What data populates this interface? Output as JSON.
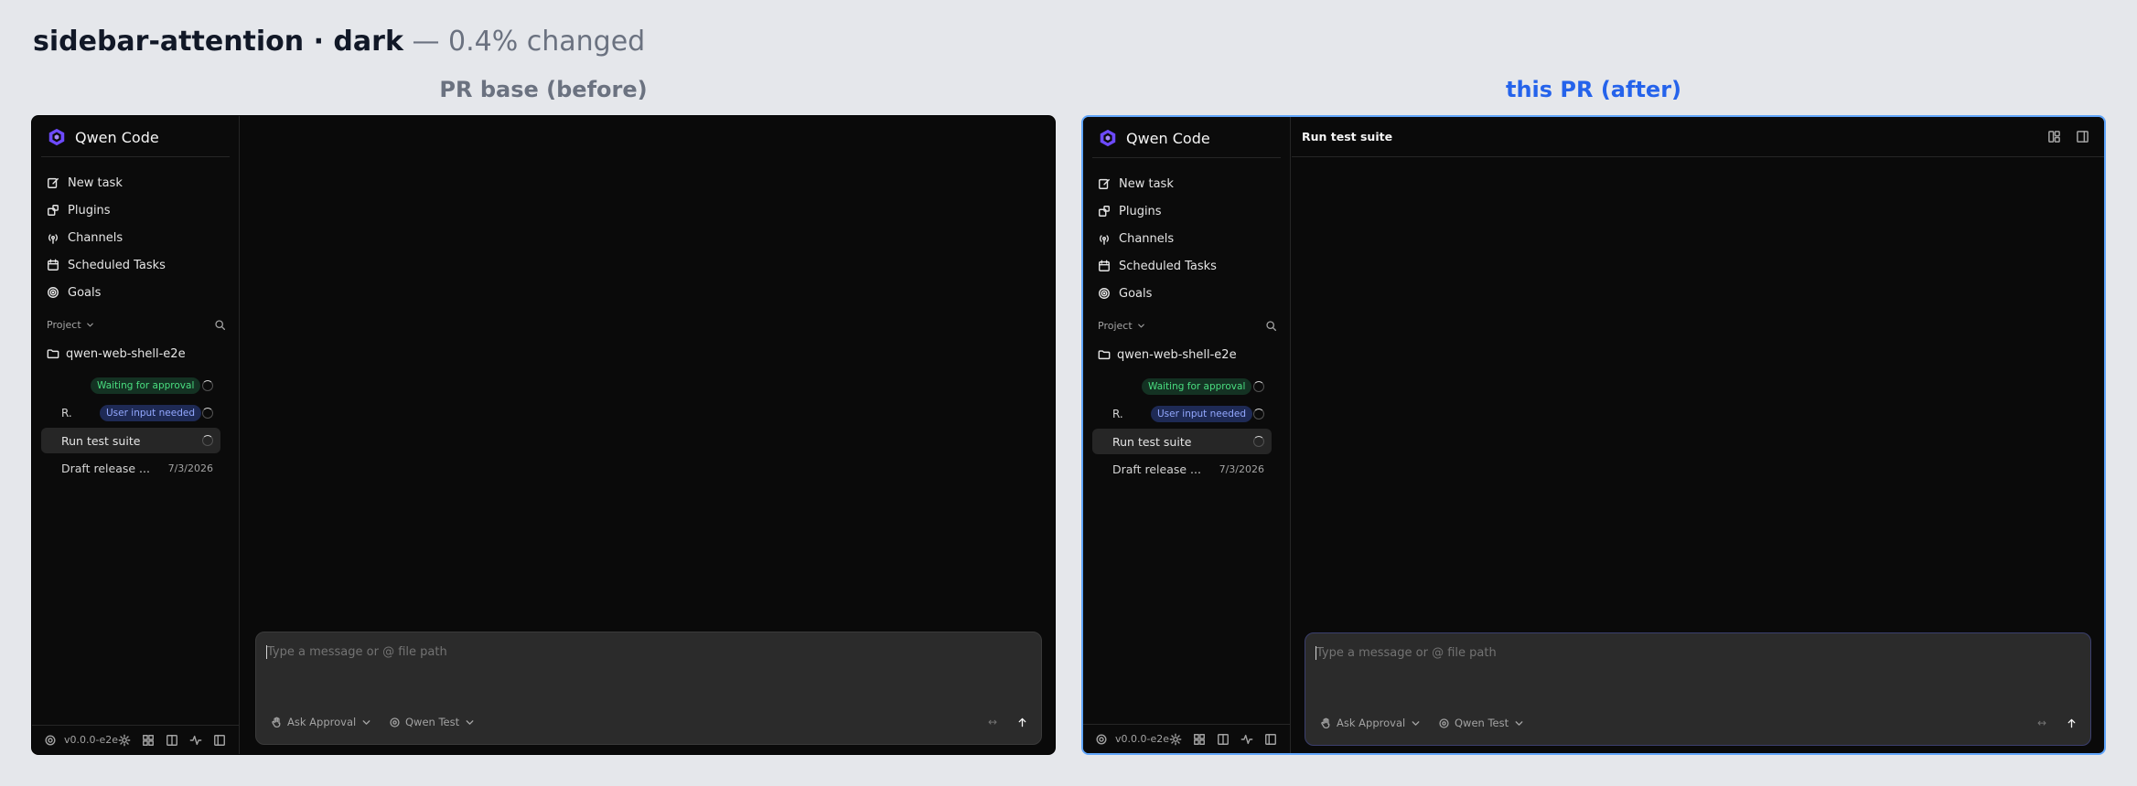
{
  "heading": {
    "title": "sidebar-attention · dark",
    "subtitle": "— 0.4% changed"
  },
  "columns": {
    "before_label": "PR base (before)",
    "after_label": "this PR (after)"
  },
  "app": {
    "name": "Qwen Code",
    "nav": [
      "New task",
      "Plugins",
      "Channels",
      "Scheduled Tasks",
      "Goals"
    ],
    "project_label": "Project",
    "folder": "qwen-web-shell-e2e",
    "tasks": {
      "waiting_badge": "Waiting for approval",
      "user_prefix": "R.",
      "user_badge": "User input needed",
      "active_title": "Run test suite",
      "draft_title": "Draft release ...",
      "draft_date": "7/3/2026"
    },
    "version": "v0.0.0-e2e",
    "topbar_title": "Run test suite",
    "composer": {
      "placeholder": "Type a message or @ file path",
      "approval": "Ask Approval",
      "model": "Qwen Test",
      "expand": "↔"
    }
  },
  "colors": {
    "background": "#e5e7eb",
    "after_accent": "#2563eb",
    "waiting_badge": "#4ade80",
    "input_badge": "#93a8ff"
  }
}
